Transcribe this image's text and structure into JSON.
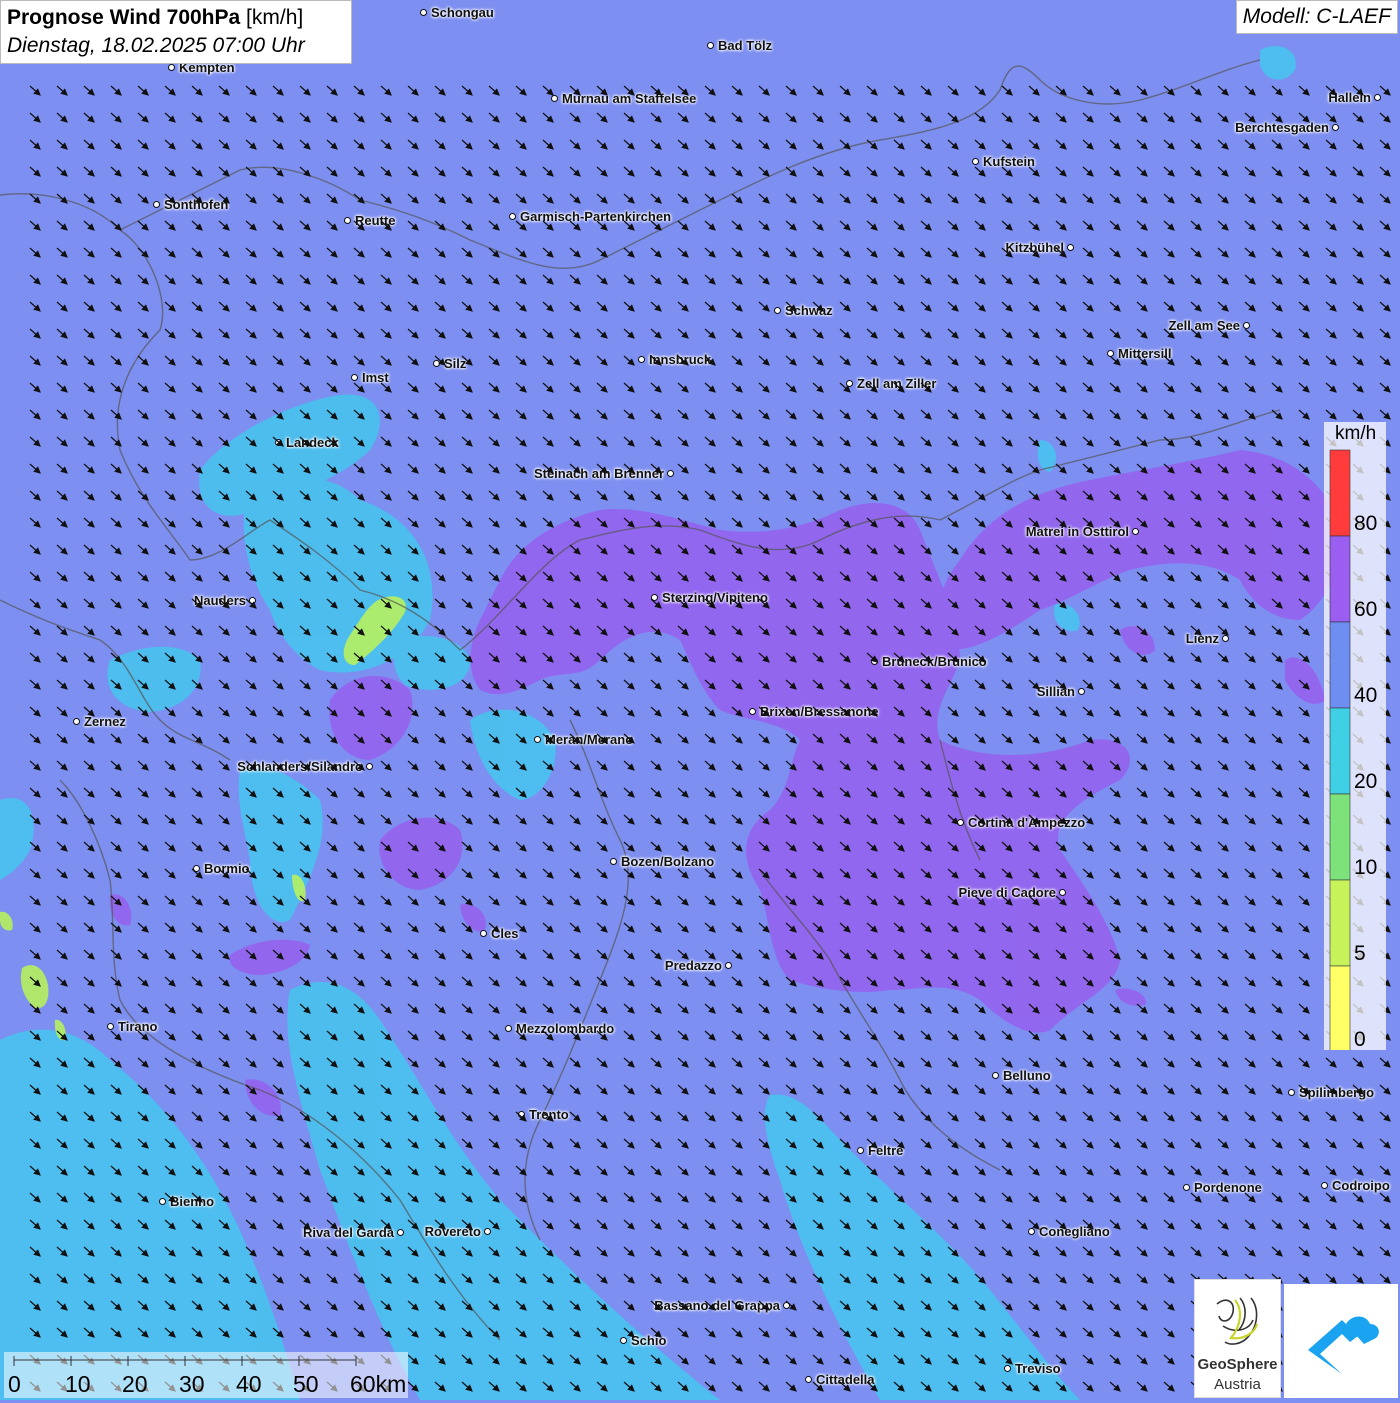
{
  "header": {
    "title_bold": "Prognose Wind 700hPa",
    "title_unit": "[km/h]",
    "datetime": "Dienstag, 18.02.2025 07:00 Uhr"
  },
  "model_label": "Modell: C-LAEF",
  "legend": {
    "unit": "km/h",
    "bins": [
      {
        "from": 0,
        "to": 5,
        "color": "#ffff66"
      },
      {
        "from": 5,
        "to": 10,
        "color": "#c8f25a"
      },
      {
        "from": 10,
        "to": 20,
        "color": "#7de27a"
      },
      {
        "from": 20,
        "to": 40,
        "color": "#3fd0e6"
      },
      {
        "from": 40,
        "to": 60,
        "color": "#6f8ef2"
      },
      {
        "from": 60,
        "to": 80,
        "color": "#9a5ef0"
      },
      {
        "from": 80,
        "to": 100,
        "color": "#ff3b3b"
      }
    ],
    "labels": [
      "0",
      "5",
      "10",
      "20",
      "40",
      "60",
      "80"
    ]
  },
  "scale_bar": {
    "labels": [
      "0",
      "10",
      "20",
      "30",
      "40",
      "50",
      "60km"
    ]
  },
  "cities": [
    {
      "name": "Schongau"
    },
    {
      "name": "Bad Tölz"
    },
    {
      "name": "Kempten"
    },
    {
      "name": "Murnau am Staffelsee"
    },
    {
      "name": "Hallein"
    },
    {
      "name": "Berchtesgaden"
    },
    {
      "name": "Kufstein"
    },
    {
      "name": "Sonthofen"
    },
    {
      "name": "Reutte"
    },
    {
      "name": "Garmisch-Partenkirchen"
    },
    {
      "name": "Kitzbühel"
    },
    {
      "name": "Schwaz"
    },
    {
      "name": "Zell am See"
    },
    {
      "name": "Mittersill"
    },
    {
      "name": "Innsbruck"
    },
    {
      "name": "Silz"
    },
    {
      "name": "Imst"
    },
    {
      "name": "Zell am Ziller"
    },
    {
      "name": "Landeck"
    },
    {
      "name": "Steinach am Brenner"
    },
    {
      "name": "Matrei in Osttirol"
    },
    {
      "name": "Nauders"
    },
    {
      "name": "Sterzing/Vipiteno"
    },
    {
      "name": "Lienz"
    },
    {
      "name": "Bruneck/Brunico"
    },
    {
      "name": "Sillian"
    },
    {
      "name": "Zernez"
    },
    {
      "name": "Brixen/Bressanone"
    },
    {
      "name": "Meran/Merano"
    },
    {
      "name": "Schlanders/Silandro"
    },
    {
      "name": "Cortina d'Ampezzo"
    },
    {
      "name": "Bozen/Bolzano"
    },
    {
      "name": "Bormio"
    },
    {
      "name": "Pieve di Cadore"
    },
    {
      "name": "Cles"
    },
    {
      "name": "Predazzo"
    },
    {
      "name": "Tirano"
    },
    {
      "name": "Mezzolombardo"
    },
    {
      "name": "Belluno"
    },
    {
      "name": "Spilimbergo"
    },
    {
      "name": "Trento"
    },
    {
      "name": "Feltre"
    },
    {
      "name": "Pordenone"
    },
    {
      "name": "Codroipo"
    },
    {
      "name": "Bienno"
    },
    {
      "name": "Riva del Garda"
    },
    {
      "name": "Rovereto"
    },
    {
      "name": "Conegliano"
    },
    {
      "name": "Bassano del Grappa"
    },
    {
      "name": "Schio"
    },
    {
      "name": "Treviso"
    },
    {
      "name": "Cittadella"
    }
  ],
  "wind": {
    "direction_to": "south-east"
  },
  "logos": {
    "geosphere_line1": "GeoSphere",
    "geosphere_line2": "Austria"
  },
  "colors": {
    "background": "#7d8ff0",
    "cyan_zone": "#45c6ee",
    "purple_zone": "#9563ee",
    "green_zone": "#b6f05e"
  }
}
